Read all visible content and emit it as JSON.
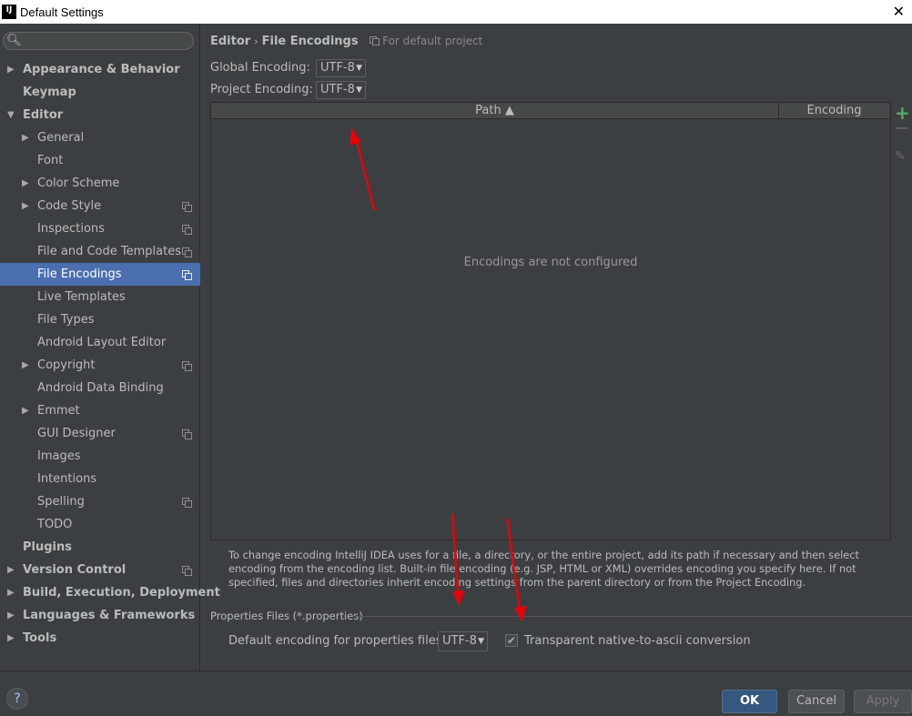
{
  "window": {
    "title": "Default Settings",
    "logo_text": "IJ"
  },
  "search": {
    "placeholder": ""
  },
  "sidebar": {
    "items": [
      {
        "label": "Appearance & Behavior",
        "level": 0,
        "bold": true,
        "arrow": true,
        "copy": false,
        "selected": false
      },
      {
        "label": "Keymap",
        "level": 0,
        "bold": true,
        "arrow": false,
        "copy": false,
        "selected": false
      },
      {
        "label": "Editor",
        "level": 0,
        "bold": true,
        "arrow": "down",
        "copy": false,
        "selected": false
      },
      {
        "label": "General",
        "level": 1,
        "bold": false,
        "arrow": true,
        "copy": false,
        "selected": false
      },
      {
        "label": "Font",
        "level": 1,
        "bold": false,
        "arrow": false,
        "copy": false,
        "selected": false
      },
      {
        "label": "Color Scheme",
        "level": 1,
        "bold": false,
        "arrow": true,
        "copy": false,
        "selected": false
      },
      {
        "label": "Code Style",
        "level": 1,
        "bold": false,
        "arrow": true,
        "copy": true,
        "selected": false
      },
      {
        "label": "Inspections",
        "level": 1,
        "bold": false,
        "arrow": false,
        "copy": true,
        "selected": false
      },
      {
        "label": "File and Code Templates",
        "level": 1,
        "bold": false,
        "arrow": false,
        "copy": true,
        "selected": false
      },
      {
        "label": "File Encodings",
        "level": 1,
        "bold": false,
        "arrow": false,
        "copy": true,
        "selected": true
      },
      {
        "label": "Live Templates",
        "level": 1,
        "bold": false,
        "arrow": false,
        "copy": false,
        "selected": false
      },
      {
        "label": "File Types",
        "level": 1,
        "bold": false,
        "arrow": false,
        "copy": false,
        "selected": false
      },
      {
        "label": "Android Layout Editor",
        "level": 1,
        "bold": false,
        "arrow": false,
        "copy": false,
        "selected": false
      },
      {
        "label": "Copyright",
        "level": 1,
        "bold": false,
        "arrow": true,
        "copy": true,
        "selected": false
      },
      {
        "label": "Android Data Binding",
        "level": 1,
        "bold": false,
        "arrow": false,
        "copy": false,
        "selected": false
      },
      {
        "label": "Emmet",
        "level": 1,
        "bold": false,
        "arrow": true,
        "copy": false,
        "selected": false
      },
      {
        "label": "GUI Designer",
        "level": 1,
        "bold": false,
        "arrow": false,
        "copy": true,
        "selected": false
      },
      {
        "label": "Images",
        "level": 1,
        "bold": false,
        "arrow": false,
        "copy": false,
        "selected": false
      },
      {
        "label": "Intentions",
        "level": 1,
        "bold": false,
        "arrow": false,
        "copy": false,
        "selected": false
      },
      {
        "label": "Spelling",
        "level": 1,
        "bold": false,
        "arrow": false,
        "copy": true,
        "selected": false
      },
      {
        "label": "TODO",
        "level": 1,
        "bold": false,
        "arrow": false,
        "copy": false,
        "selected": false
      },
      {
        "label": "Plugins",
        "level": 0,
        "bold": true,
        "arrow": false,
        "copy": false,
        "selected": false
      },
      {
        "label": "Version Control",
        "level": 0,
        "bold": true,
        "arrow": true,
        "copy": true,
        "selected": false
      },
      {
        "label": "Build, Execution, Deployment",
        "level": 0,
        "bold": true,
        "arrow": true,
        "copy": false,
        "selected": false
      },
      {
        "label": "Languages & Frameworks",
        "level": 0,
        "bold": true,
        "arrow": true,
        "copy": false,
        "selected": false
      },
      {
        "label": "Tools",
        "level": 0,
        "bold": true,
        "arrow": true,
        "copy": false,
        "selected": false
      }
    ]
  },
  "main": {
    "breadcrumb": {
      "parent": "Editor",
      "separator": "›",
      "current": "File Encodings",
      "scope": "For default project"
    },
    "global_encoding": {
      "label": "Global Encoding:",
      "value": "UTF-8"
    },
    "project_encoding": {
      "label": "Project Encoding:",
      "value": "UTF-8"
    },
    "table": {
      "columns": [
        "Path ▲",
        "Encoding"
      ],
      "empty_text": "Encodings are not configured"
    },
    "tools": {
      "add": "+",
      "edit": "✎"
    },
    "help_text": "To change encoding IntelliJ IDEA uses for a file, a directory, or the entire project, add its path if necessary and then select encoding from the encoding list. Built-in file encoding (e.g. JSP, HTML or XML) overrides encoding you specify here. If not specified, files and directories inherit encoding settings from the parent directory or from the Project Encoding.",
    "properties": {
      "section_title": "Properties Files (*.properties)",
      "default_label": "Default encoding for properties files:",
      "default_value": "UTF-8",
      "transparent_checked": true,
      "transparent_label": "Transparent native-to-ascii conversion"
    }
  },
  "footer": {
    "help": "?",
    "ok": "OK",
    "cancel": "Cancel",
    "apply": "Apply"
  },
  "colors": {
    "background": "#3c3f41",
    "selection": "#4b6eaf",
    "ok_button": "#365880",
    "add_icon": "#59a869",
    "annotation_arrow": "#e8000b"
  }
}
